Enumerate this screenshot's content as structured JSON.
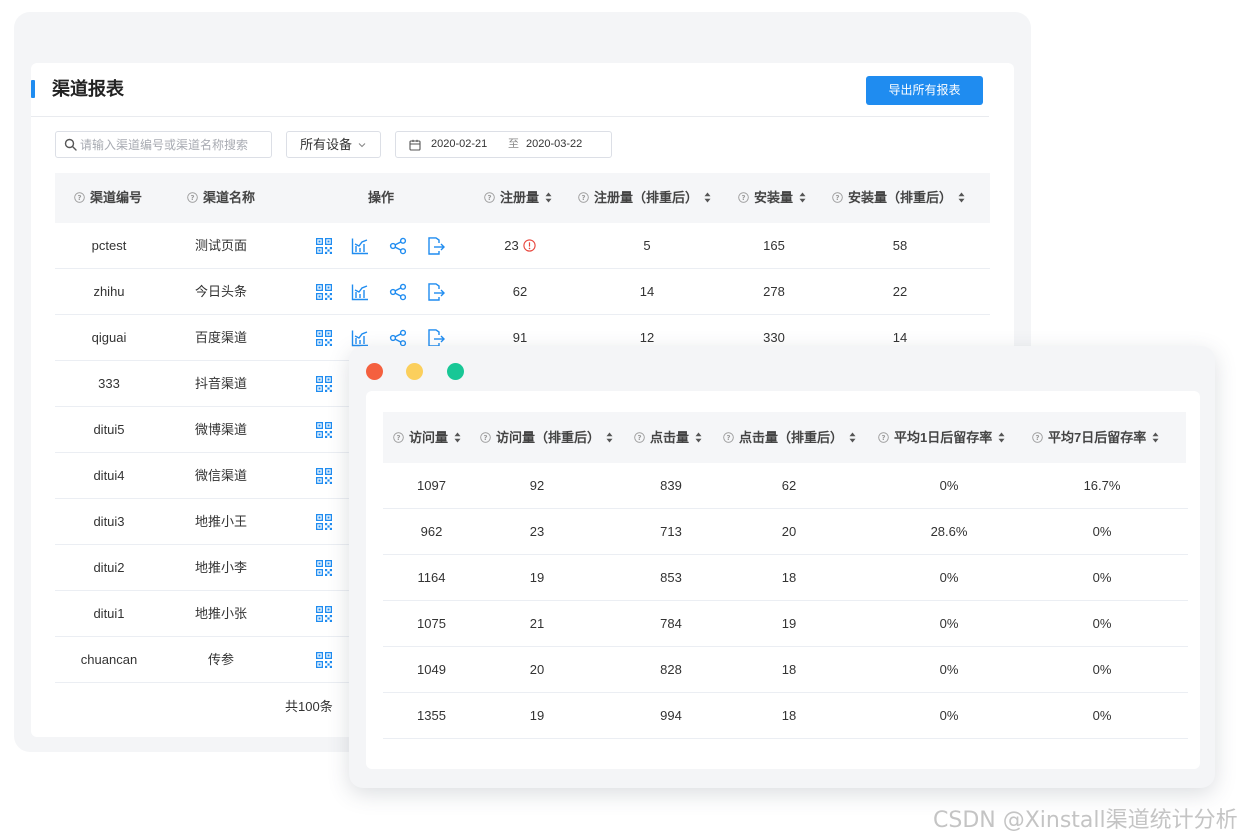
{
  "back_window": {
    "title": "渠道报表",
    "export_button": "导出所有报表",
    "search": {
      "placeholder": "请输入渠道编号或渠道名称搜索",
      "value": ""
    },
    "device_select": "所有设备",
    "date_range": {
      "start": "2020-02-21",
      "separator": "至",
      "end": "2020-03-22"
    },
    "columns": {
      "code": "渠道编号",
      "name": "渠道名称",
      "ops": "操作",
      "reg": "注册量",
      "reg_dedup": "注册量（排重后）",
      "install": "安装量",
      "install_dedup": "安装量（排重后）"
    },
    "rows": [
      {
        "code": "pctest",
        "name": "测试页面",
        "reg": "23",
        "reg_dedup": "5",
        "install": "165",
        "install_dedup": "58"
      },
      {
        "code": "zhihu",
        "name": "今日头条",
        "reg": "62",
        "reg_dedup": "14",
        "install": "278",
        "install_dedup": "22"
      },
      {
        "code": "qiguai",
        "name": "百度渠道",
        "reg": "91",
        "reg_dedup": "12",
        "install": "330",
        "install_dedup": "14"
      },
      {
        "code": "333",
        "name": "抖音渠道"
      },
      {
        "code": "ditui5",
        "name": "微博渠道"
      },
      {
        "code": "ditui4",
        "name": "微信渠道"
      },
      {
        "code": "ditui3",
        "name": "地推小王"
      },
      {
        "code": "ditui2",
        "name": "地推小李"
      },
      {
        "code": "ditui1",
        "name": "地推小张"
      },
      {
        "code": "chuancan",
        "name": "传参"
      }
    ],
    "total": "共100条",
    "icons": [
      "qrcode-icon",
      "chart-icon",
      "share-icon",
      "export-icon"
    ],
    "accent_color": "#1f8cf0"
  },
  "front_window": {
    "window_dots": [
      "#f4603f",
      "#fbcf5c",
      "#18c796"
    ],
    "columns": {
      "visits": "访问量",
      "visits_dedup": "访问量（排重后）",
      "clicks": "点击量",
      "clicks_dedup": "点击量（排重后）",
      "retention_1d": "平均1日后留存率",
      "retention_7d": "平均7日后留存率"
    },
    "rows": [
      {
        "visits": "1097",
        "visits_dedup": "92",
        "clicks": "839",
        "clicks_dedup": "62",
        "retention_1d": "0%",
        "retention_7d": "16.7%"
      },
      {
        "visits": "962",
        "visits_dedup": "23",
        "clicks": "713",
        "clicks_dedup": "20",
        "retention_1d": "28.6%",
        "retention_7d": "0%"
      },
      {
        "visits": "1164",
        "visits_dedup": "19",
        "clicks": "853",
        "clicks_dedup": "18",
        "retention_1d": "0%",
        "retention_7d": "0%"
      },
      {
        "visits": "1075",
        "visits_dedup": "21",
        "clicks": "784",
        "clicks_dedup": "19",
        "retention_1d": "0%",
        "retention_7d": "0%"
      },
      {
        "visits": "1049",
        "visits_dedup": "20",
        "clicks": "828",
        "clicks_dedup": "18",
        "retention_1d": "0%",
        "retention_7d": "0%"
      },
      {
        "visits": "1355",
        "visits_dedup": "19",
        "clicks": "994",
        "clicks_dedup": "18",
        "retention_1d": "0%",
        "retention_7d": "0%"
      }
    ]
  },
  "watermark": "CSDN @Xinstall渠道统计分析"
}
